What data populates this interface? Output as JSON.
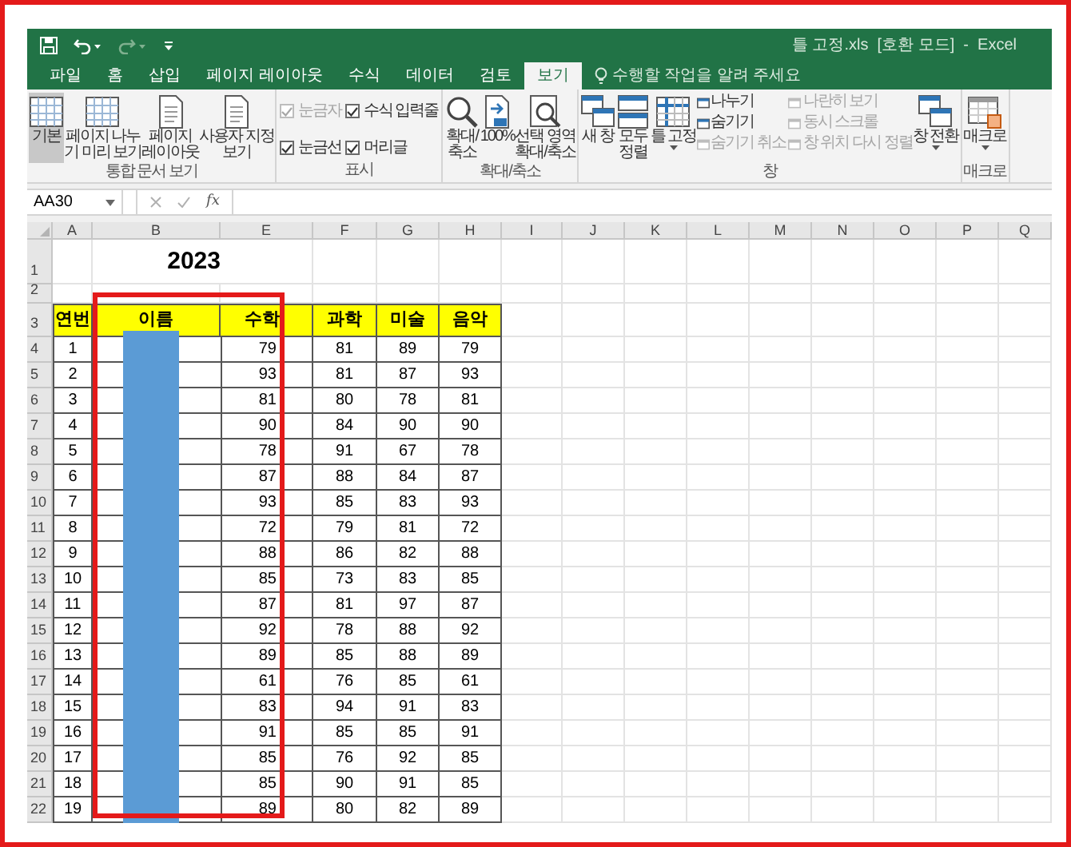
{
  "window": {
    "title": "틀 고정.xls  [호환 모드]  -  Excel"
  },
  "tabs": [
    {
      "label": "파일",
      "selected": false
    },
    {
      "label": "홈",
      "selected": false
    },
    {
      "label": "삽입",
      "selected": false
    },
    {
      "label": "페이지 레이아웃",
      "selected": false
    },
    {
      "label": "수식",
      "selected": false
    },
    {
      "label": "데이터",
      "selected": false
    },
    {
      "label": "검토",
      "selected": false
    },
    {
      "label": "보기",
      "selected": true
    }
  ],
  "tell_me": {
    "placeholder": "수행할 작업을 알려 주세요"
  },
  "ribbon": {
    "groups": [
      {
        "label": "통합 문서 보기",
        "items": [
          {
            "kind": "large",
            "label": "기본",
            "selected": true
          },
          {
            "kind": "large",
            "label": "페이지 나누\n기 미리 보기",
            "selected": false
          },
          {
            "kind": "large",
            "label": "페이지\n레이아웃",
            "selected": false
          },
          {
            "kind": "large",
            "label": "사용자 지정\n보기",
            "selected": false
          }
        ]
      },
      {
        "label": "표시",
        "items": [
          {
            "kind": "check",
            "label": "눈금자",
            "checked": true,
            "disabled": true
          },
          {
            "kind": "check",
            "label": "눈금선",
            "checked": true,
            "disabled": false
          },
          {
            "kind": "check",
            "label": "수식 입력줄",
            "checked": true,
            "disabled": false
          },
          {
            "kind": "check",
            "label": "머리글",
            "checked": true,
            "disabled": false
          }
        ]
      },
      {
        "label": "확대/축소",
        "items": [
          {
            "kind": "large",
            "label": "확대/\n축소",
            "selected": false
          },
          {
            "kind": "large",
            "label": "100%",
            "selected": false
          },
          {
            "kind": "large",
            "label": "선택 영역\n확대/축소",
            "selected": false
          }
        ]
      },
      {
        "label": "창",
        "items": [
          {
            "kind": "large",
            "label": "새 창",
            "selected": false
          },
          {
            "kind": "large",
            "label": "모두\n정렬",
            "selected": false
          },
          {
            "kind": "large",
            "label": "틀 고정",
            "selected": false,
            "dropdown": true
          },
          {
            "kind": "small",
            "label": "나누기",
            "disabled": false
          },
          {
            "kind": "small",
            "label": "숨기기",
            "disabled": false
          },
          {
            "kind": "small",
            "label": "숨기기 취소",
            "disabled": true
          },
          {
            "kind": "small",
            "label": "나란히 보기",
            "disabled": true
          },
          {
            "kind": "small",
            "label": "동시 스크롤",
            "disabled": true
          },
          {
            "kind": "small",
            "label": "창 위치 다시 정렬",
            "disabled": true
          },
          {
            "kind": "large",
            "label": "창 전환",
            "selected": false,
            "dropdown": true
          }
        ]
      },
      {
        "label": "매크로",
        "items": [
          {
            "kind": "large",
            "label": "매크로",
            "selected": false,
            "dropdown": true
          }
        ]
      }
    ]
  },
  "formula_bar": {
    "name_box": "AA30",
    "function_button": "fx"
  },
  "row_numbers": [
    "1",
    "2",
    "3",
    "4",
    "5",
    "6",
    "7",
    "8",
    "9",
    "10",
    "11",
    "12",
    "13",
    "14",
    "15",
    "16",
    "17",
    "18",
    "19",
    "20",
    "21",
    "22"
  ],
  "columns": [
    "A",
    "B",
    "E",
    "F",
    "G",
    "H",
    "I",
    "J",
    "K",
    "L",
    "M",
    "N",
    "O",
    "P",
    "Q"
  ],
  "sheet": {
    "title": "2023",
    "headers": [
      "연번",
      "이름",
      "수학",
      "과학",
      "미술",
      "음악"
    ],
    "rows": [
      [
        "1",
        "79",
        "81",
        "89",
        "79"
      ],
      [
        "2",
        "93",
        "81",
        "87",
        "93"
      ],
      [
        "3",
        "81",
        "80",
        "78",
        "81"
      ],
      [
        "4",
        "90",
        "84",
        "90",
        "90"
      ],
      [
        "5",
        "78",
        "91",
        "67",
        "78"
      ],
      [
        "6",
        "87",
        "88",
        "84",
        "87"
      ],
      [
        "7",
        "93",
        "85",
        "83",
        "93"
      ],
      [
        "8",
        "72",
        "79",
        "81",
        "72"
      ],
      [
        "9",
        "88",
        "86",
        "82",
        "88"
      ],
      [
        "10",
        "85",
        "73",
        "83",
        "85"
      ],
      [
        "11",
        "87",
        "81",
        "97",
        "87"
      ],
      [
        "12",
        "92",
        "78",
        "88",
        "92"
      ],
      [
        "13",
        "89",
        "85",
        "88",
        "89"
      ],
      [
        "14",
        "61",
        "76",
        "85",
        "61"
      ],
      [
        "15",
        "83",
        "94",
        "91",
        "83"
      ],
      [
        "16",
        "91",
        "85",
        "85",
        "91"
      ],
      [
        "17",
        "85",
        "76",
        "92",
        "85"
      ],
      [
        "18",
        "85",
        "90",
        "91",
        "85"
      ],
      [
        "19",
        "89",
        "80",
        "82",
        "89"
      ]
    ]
  },
  "annotations": [
    {
      "kind": "redaction",
      "color": "#5b9bd5"
    },
    {
      "kind": "highlight_box",
      "color": "#e41a1a"
    }
  ]
}
